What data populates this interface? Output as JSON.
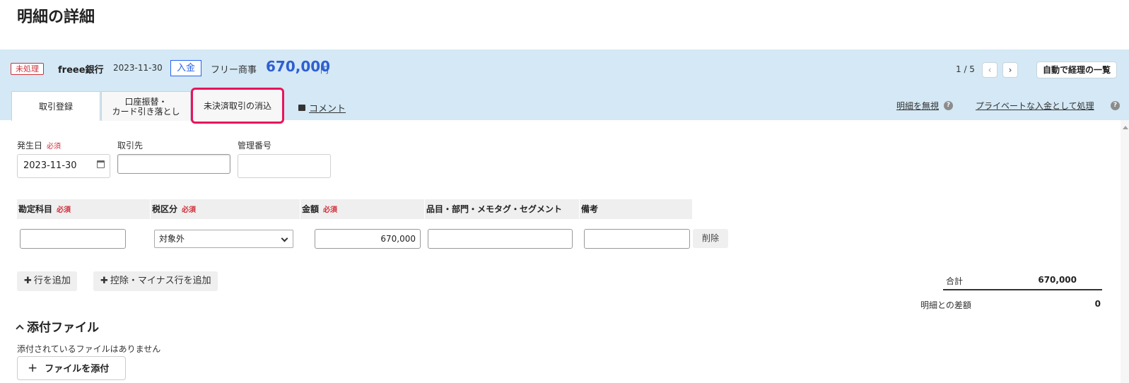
{
  "page": {
    "title": "明細の詳細"
  },
  "statement": {
    "status": "未処理",
    "bank": "freee銀行",
    "date": "2023-11-30",
    "direction": "入金",
    "partner": "フリー商事",
    "amount": "670,000",
    "unit": "円"
  },
  "pager": {
    "position": "1 / 5",
    "prev": "‹",
    "next": "›",
    "auto_list": "自動で経理の一覧"
  },
  "tabs": {
    "register": "取引登録",
    "transfer_line1": "口座振替・",
    "transfer_line2": "カード引き落とし",
    "settle": "未決済取引の消込"
  },
  "comment": "コメント",
  "actions": {
    "ignore": "明細を無視",
    "private": "プライベートな入金として処理",
    "help": "?"
  },
  "form": {
    "issue_date_label": "発生日",
    "required": "必須",
    "issue_date_value": "2023-11-30",
    "partner_label": "取引先",
    "partner_value": "",
    "ref_label": "管理番号",
    "ref_value": ""
  },
  "table": {
    "headers": {
      "account": "勘定科目",
      "tax": "税区分",
      "amount": "金額",
      "tags": "品目・部門・メモタグ・セグメント",
      "note": "備考"
    },
    "row": {
      "account": "",
      "tax": "対象外",
      "amount": "670,000",
      "tags": "",
      "note": ""
    },
    "delete": "削除"
  },
  "buttons": {
    "add_row": "行を追加",
    "add_minus_row": "控除・マイナス行を追加"
  },
  "totals": {
    "total_label": "合計",
    "total_value": "670,000",
    "diff_label": "明細との差額",
    "diff_value": "0"
  },
  "attachments": {
    "title": "添付ファイル",
    "empty": "添付されているファイルはありません",
    "add": "ファイルを添付"
  }
}
